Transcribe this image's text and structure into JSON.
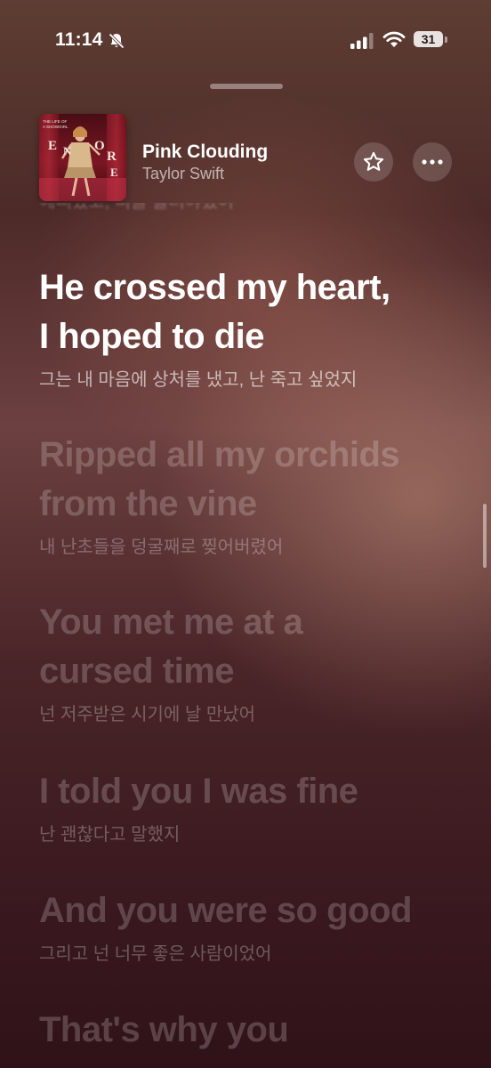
{
  "status_bar": {
    "time": "11:14",
    "battery": "31",
    "icons": [
      "bell-slash-icon",
      "cellular-signal-icon",
      "wifi-icon",
      "battery-icon"
    ]
  },
  "now_playing": {
    "title": "Pink Clouding",
    "artist": "Taylor Swift",
    "album_art_text": "THE ENCORE",
    "album_art_small_text": "THE LIFE OF A SHOWGIRL",
    "star_icon": "star-icon",
    "more_icon": "ellipsis-icon"
  },
  "lyrics": {
    "previous_translation_fragment": "예뻐었고, 피를 흘려야했어",
    "lines": [
      {
        "state": "active",
        "text_lines": [
          "He crossed my heart,",
          "I hoped to die"
        ],
        "translation": "그는 내 마음에 상처를 냈고, 난 죽고 싶었지"
      },
      {
        "state": "upcoming",
        "text_lines": [
          "Ripped all my orchids",
          "from the vine"
        ],
        "translation": "내 난초들을 덩굴째로 찢어버렸어"
      },
      {
        "state": "upcoming",
        "text_lines": [
          "You met me at a",
          "cursed time"
        ],
        "translation": "넌 저주받은 시기에 날 만났어"
      },
      {
        "state": "upcoming",
        "text_lines": [
          "I told you I was fine"
        ],
        "translation": "난 괜찮다고 말했지"
      },
      {
        "state": "upcoming",
        "text_lines": [
          "And you were so good"
        ],
        "translation": "그리고 넌 너무 좋은 사람이었어"
      },
      {
        "state": "upcoming",
        "text_lines": [
          "That's why you"
        ],
        "translation": ""
      }
    ]
  },
  "colors": {
    "active_lyric": "#ffffff",
    "background_top": "#5e3d33",
    "background_bottom": "#2f1218"
  }
}
